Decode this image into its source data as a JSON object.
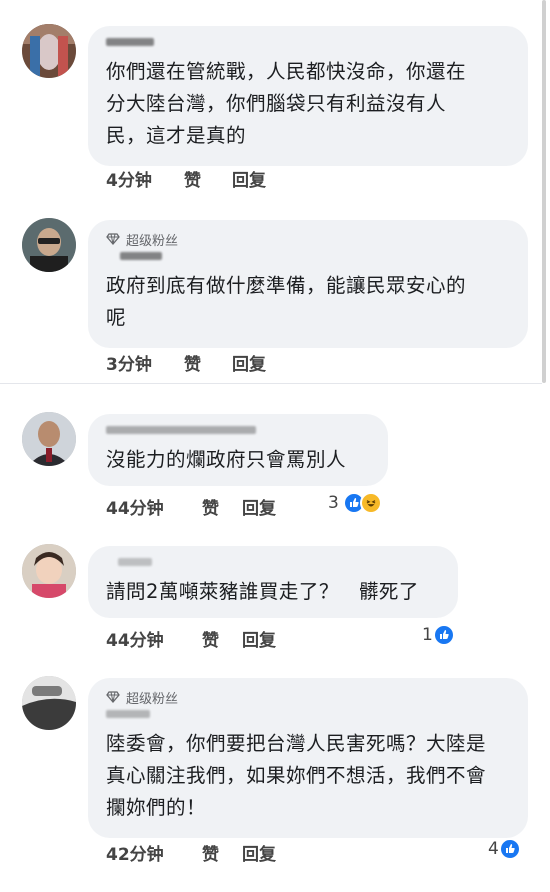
{
  "comments": [
    {
      "badge": "",
      "text": "你們還在管統戰，人民都快沒命，你還在\n分大陸台灣，你們腦袋只有利益沒有人\n民，這才是真的",
      "time": "4分钟",
      "like_label": "赞",
      "reply_label": "回复",
      "reaction_count": ""
    },
    {
      "badge": "超级粉丝",
      "text": "政府到底有做什麼準備，能讓民眾安心的\n呢",
      "time": "3分钟",
      "like_label": "赞",
      "reply_label": "回复",
      "reaction_count": ""
    },
    {
      "badge": "",
      "text": "沒能力的爛政府只會罵別人",
      "time": "44分钟",
      "like_label": "赞",
      "reply_label": "回复",
      "reaction_count": "3"
    },
    {
      "badge": "",
      "text": "請問2萬噸萊豬誰買走了？　髒死了",
      "time": "44分钟",
      "like_label": "赞",
      "reply_label": "回复",
      "reaction_count": "1"
    },
    {
      "badge": "超级粉丝",
      "text": "陸委會，你們要把台灣人民害死嗎？大陸是\n真心關注我們，如果妳們不想活，我們不會\n攔妳們的！",
      "time": "42分钟",
      "like_label": "赞",
      "reply_label": "回复",
      "reaction_count": "4"
    }
  ],
  "icons": {
    "fan_badge": "diamond-icon",
    "like_reaction": "thumbs-up-icon",
    "haha_reaction": "laughing-face-icon"
  },
  "colors": {
    "bubble": "#f0f2f5",
    "like_blue": "#1877f2",
    "haha_yellow": "#f7b928",
    "meta_text": "#444444"
  }
}
